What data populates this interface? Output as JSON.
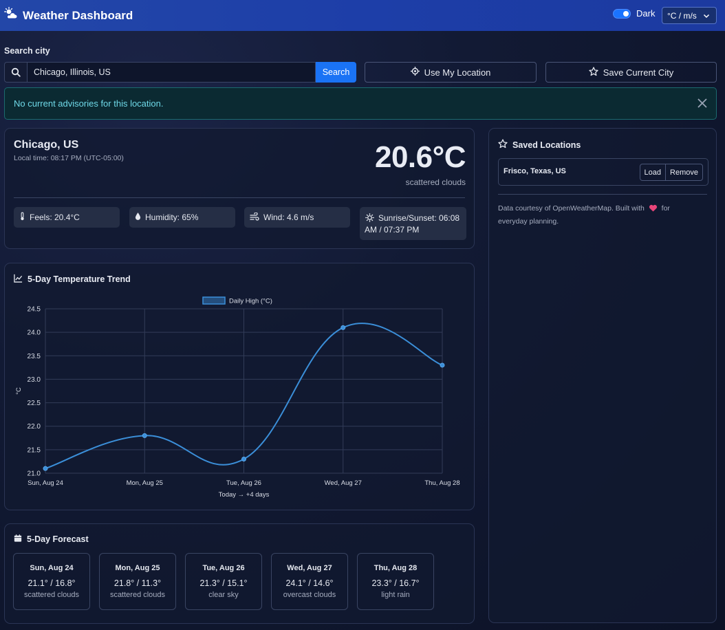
{
  "header": {
    "title": "Weather Dashboard",
    "theme_label": "Dark",
    "units_value": "°C / m/s"
  },
  "search": {
    "label": "Search city",
    "value": "Chicago, Illinois, US",
    "button": "Search",
    "use_location": "Use My Location",
    "save_city": "Save Current City"
  },
  "alert": {
    "text": "No current advisories for this location."
  },
  "current": {
    "city": "Chicago, US",
    "local_time": "Local time: 08:17 PM (UTC-05:00)",
    "temperature": "20.6°C",
    "condition": "scattered clouds",
    "feels": "Feels: 20.4°C",
    "humidity": "Humidity: 65%",
    "wind": "Wind: 4.6 m/s",
    "sun_line1": "Sunrise/Sunset: 06:08",
    "sun_line2": "AM / 07:37 PM"
  },
  "trend": {
    "title": "5-Day Temperature Trend"
  },
  "chart_data": {
    "type": "line",
    "categories": [
      "Sun, Aug 24",
      "Mon, Aug 25",
      "Tue, Aug 26",
      "Wed, Aug 27",
      "Thu, Aug 28"
    ],
    "series": [
      {
        "name": "Daily High (°C)",
        "values": [
          21.1,
          21.8,
          21.3,
          24.1,
          23.3
        ],
        "color": "#3b8fd9"
      }
    ],
    "xlabel": "Today → +4 days",
    "ylabel": "°C",
    "ylim": [
      21.0,
      24.5
    ],
    "yticks": [
      "24.5",
      "24.0",
      "23.5",
      "23.0",
      "22.5",
      "22.0",
      "21.5",
      "21.0"
    ],
    "grid": true,
    "legend": "top-center"
  },
  "forecast": {
    "title": "5-Day Forecast",
    "days": [
      {
        "day": "Sun, Aug 24",
        "temps": "21.1° / 16.8°",
        "cond": "scattered clouds"
      },
      {
        "day": "Mon, Aug 25",
        "temps": "21.8° / 11.3°",
        "cond": "scattered clouds"
      },
      {
        "day": "Tue, Aug 26",
        "temps": "21.3° / 15.1°",
        "cond": "clear sky"
      },
      {
        "day": "Wed, Aug 27",
        "temps": "24.1° / 14.6°",
        "cond": "overcast clouds"
      },
      {
        "day": "Thu, Aug 28",
        "temps": "23.3° / 16.7°",
        "cond": "light rain"
      }
    ]
  },
  "saved": {
    "title": "Saved Locations",
    "items": [
      {
        "name": "Frisco, Texas, US",
        "load": "Load",
        "remove": "Remove"
      }
    ],
    "credits_1": "Data courtesy of OpenWeatherMap. Built with",
    "credits_2": "for everyday planning."
  },
  "colors": {
    "accent": "#1a73f5",
    "header": "#1d3ea8",
    "line": "#3b8fd9",
    "heart": "#e8457a"
  }
}
